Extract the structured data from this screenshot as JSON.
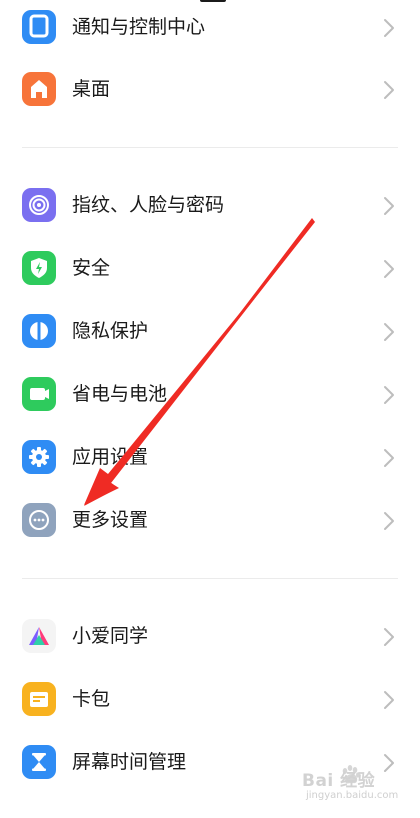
{
  "colors": {
    "accent_red": "#ef2b24",
    "chevron": "#bdbdbd",
    "divider": "#ebebeb"
  },
  "sections": [
    {
      "items": [
        {
          "label": "通知与控制中心",
          "icon": "notification-control-icon",
          "color": "#2f8cf4"
        },
        {
          "label": "桌面",
          "icon": "home-icon",
          "color": "#f7743a"
        }
      ]
    },
    {
      "items": [
        {
          "label": "指纹、人脸与密码",
          "icon": "fingerprint-icon",
          "color": "#7a6ff0"
        },
        {
          "label": "安全",
          "icon": "shield-icon",
          "color": "#2ecb5d"
        },
        {
          "label": "隐私保护",
          "icon": "privacy-icon",
          "color": "#2f8cf4"
        },
        {
          "label": "省电与电池",
          "icon": "battery-icon",
          "color": "#2ecb5d"
        },
        {
          "label": "应用设置",
          "icon": "gear-icon",
          "color": "#2f8cf4"
        },
        {
          "label": "更多设置",
          "icon": "more-dots-icon",
          "color": "#8fa3bd"
        }
      ]
    },
    {
      "items": [
        {
          "label": "小爱同学",
          "icon": "xiaoai-icon",
          "color": "#f4f4f4"
        },
        {
          "label": "卡包",
          "icon": "wallet-icon",
          "color": "#f8b21f"
        },
        {
          "label": "屏幕时间管理",
          "icon": "hourglass-icon",
          "color": "#2f8cf4"
        }
      ]
    }
  ],
  "watermark": {
    "main": "Bai 经验",
    "sub": "jingyan.baidu.com"
  }
}
